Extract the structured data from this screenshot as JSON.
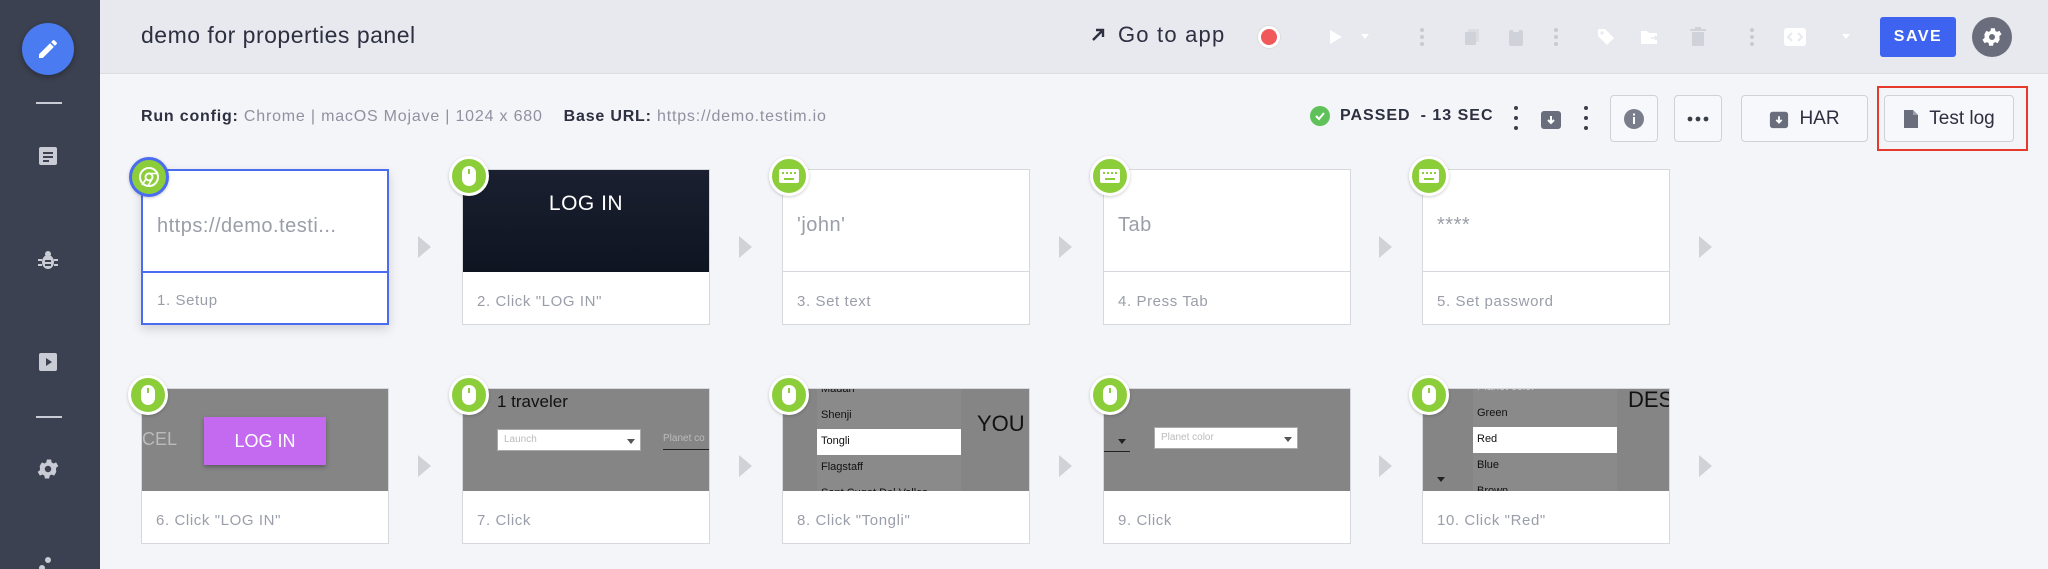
{
  "header": {
    "title": "demo for properties panel",
    "goto_label": "Go to app",
    "save_label": "SAVE"
  },
  "run": {
    "config_label": "Run config:",
    "config_value": "Chrome | macOS Mojave | 1024 x 680",
    "base_url_label": "Base URL:",
    "base_url_value": "https://demo.testim.io",
    "status": "PASSED",
    "duration": "- 13 SEC"
  },
  "toolbar": {
    "har_label": "HAR",
    "test_log_label": "Test log"
  },
  "steps": [
    {
      "label": "1. Setup",
      "thumb_text": "https://demo.testi..."
    },
    {
      "label": "2. Click \"LOG IN\"",
      "thumb_text": "LOG IN"
    },
    {
      "label": "3. Set text",
      "thumb_text": "'john'"
    },
    {
      "label": "4. Press Tab",
      "thumb_text": "Tab"
    },
    {
      "label": "5. Set password",
      "thumb_text": "****"
    },
    {
      "label": "6. Click \"LOG IN\"",
      "thumb_text": "LOG IN",
      "thumb_side": "CEL"
    },
    {
      "label": "7. Click",
      "thumb_text": "1 traveler",
      "select1": "Launch",
      "select2": "Planet co"
    },
    {
      "label": "8. Click \"Tongli\"",
      "options": [
        "Madan",
        "Shenji",
        "Tongli",
        "Flagstaff",
        "Sant Cugat Del Valles"
      ],
      "side_text": "YOU"
    },
    {
      "label": "9. Click",
      "select1": "Planet color"
    },
    {
      "label": "10. Click \"Red\"",
      "options": [
        "Planet color",
        "Green",
        "Red",
        "Blue",
        "Brown"
      ],
      "side_text": "DEST"
    }
  ],
  "colors": {
    "accent": "#3e63f0",
    "passed": "#5fc15a",
    "badge": "#8ccd3a",
    "highlight": "#e53a2c",
    "sidebar": "#3b4150"
  }
}
